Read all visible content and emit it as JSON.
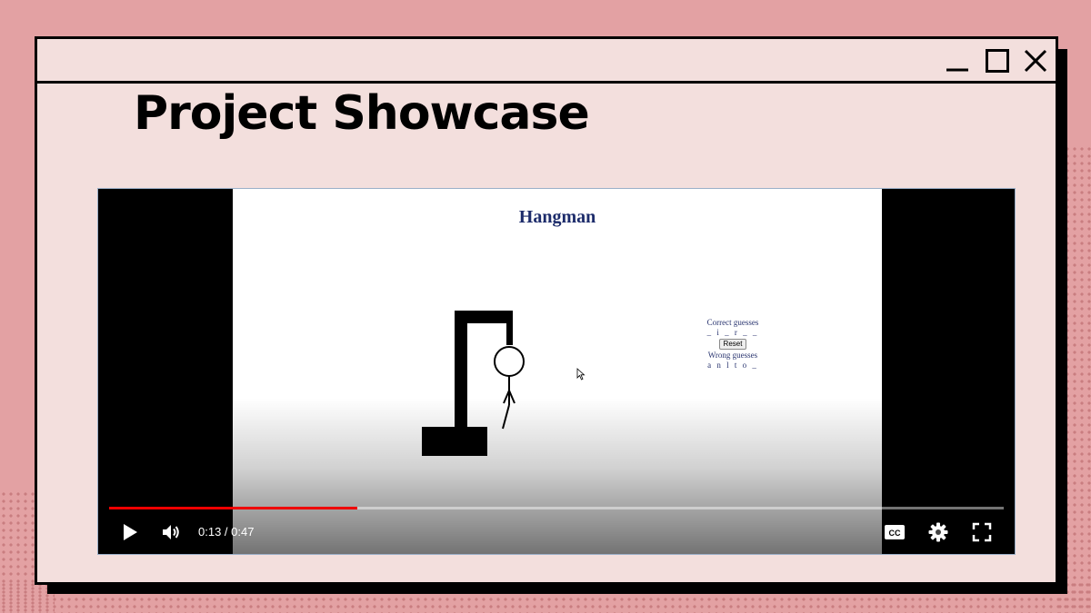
{
  "page": {
    "title": "Project Showcase"
  },
  "window": {
    "controls": [
      "minimize-icon",
      "maximize-icon",
      "close-icon"
    ]
  },
  "video": {
    "frame_title": "Hangman",
    "correct_label": "Correct guesses",
    "correct_letters": "_ i _ r _ _",
    "reset_label": "Reset",
    "wrong_label": "Wrong guesses",
    "wrong_letters": "a n l t o _",
    "current_time": "0:13",
    "duration": "0:47",
    "time_display": "0:13 / 0:47",
    "progress_fraction": 0.277,
    "colors": {
      "progress": "#ee0000",
      "frame_title": "#1d2c6b"
    }
  },
  "controls": {
    "left": [
      "play-icon",
      "volume-icon"
    ],
    "right": [
      "captions-icon",
      "settings-gear-icon",
      "fullscreen-icon"
    ]
  },
  "theme": {
    "background": "#e3a1a3",
    "window": "#f3dfdd",
    "border": "#000000"
  }
}
